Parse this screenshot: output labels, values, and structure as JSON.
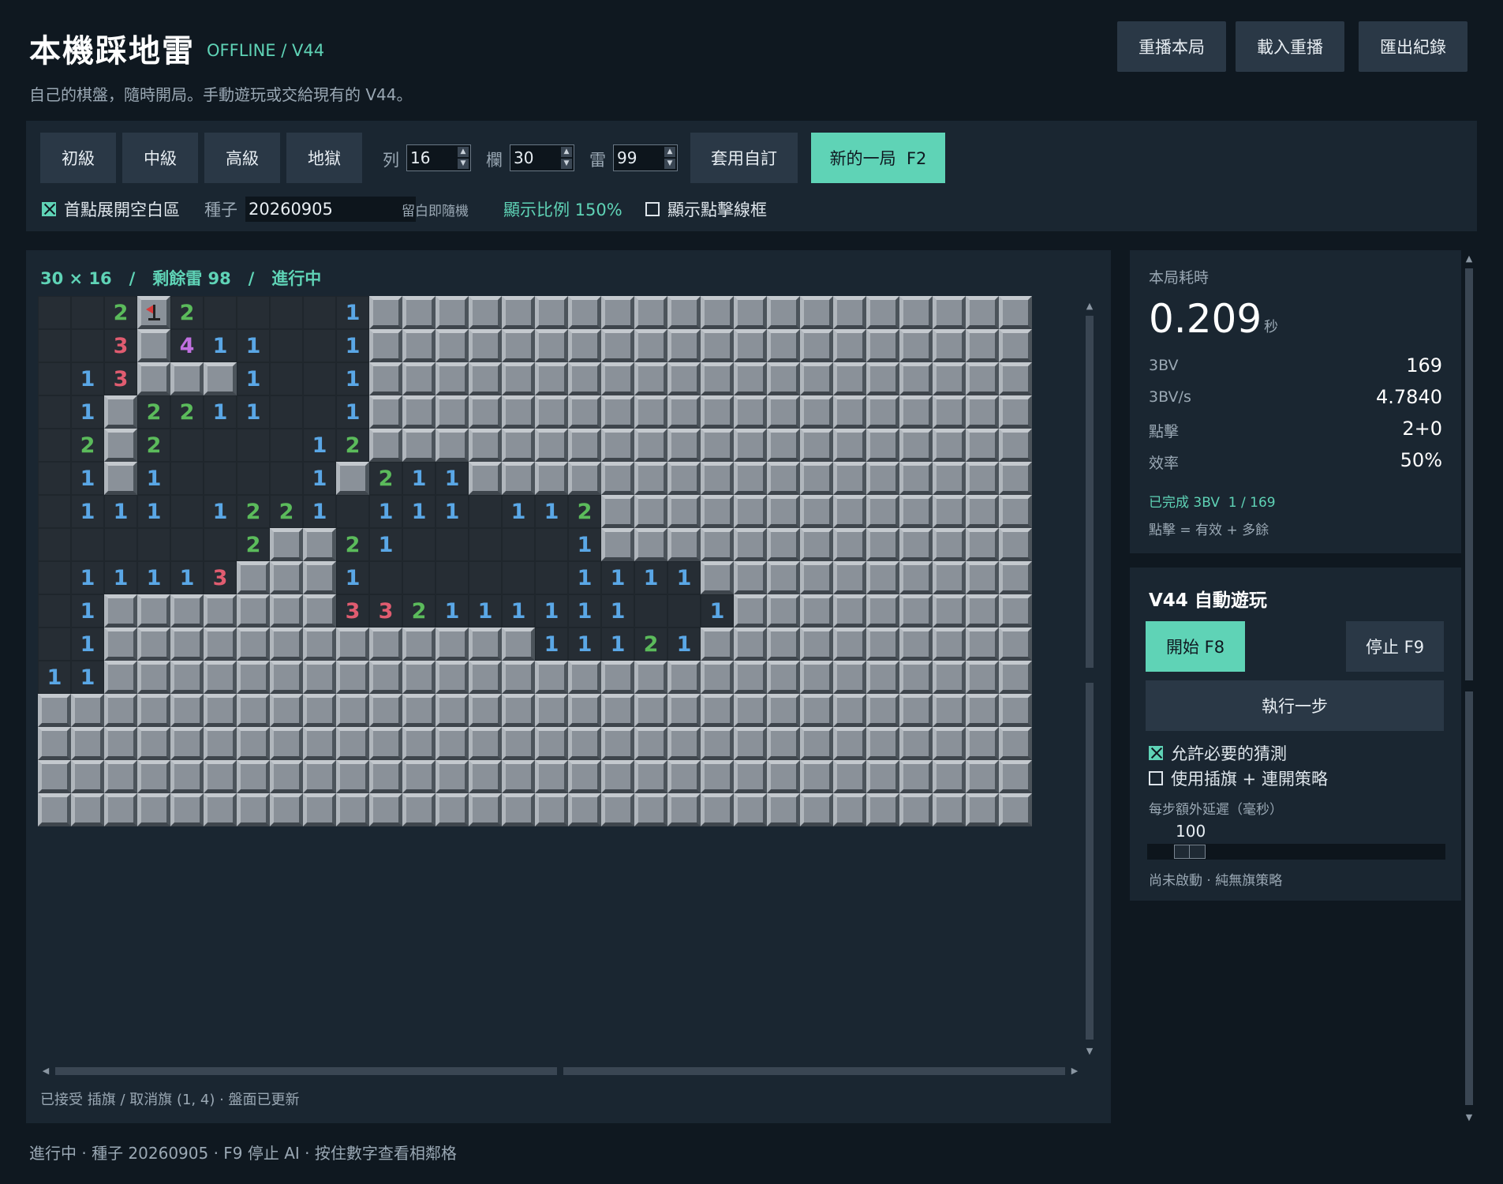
{
  "header": {
    "title": "本機踩地雷",
    "badge": "OFFLINE / V44",
    "subtitle": "自己的棋盤，隨時開局。手動遊玩或交給現有的 V44。",
    "buttons": [
      "重播本局",
      "載入重播",
      "匯出紀錄"
    ]
  },
  "toolbar": {
    "presets": [
      "初級",
      "中級",
      "高級",
      "地獄"
    ],
    "rows_label": "列",
    "rows_value": "16",
    "cols_label": "欄",
    "cols_value": "30",
    "mines_label": "雷",
    "mines_value": "99",
    "apply_custom": "套用自訂",
    "new_game": "新的一局  F2",
    "first_click_label": "首點展開空白區",
    "seed_label": "種子",
    "seed_value": "20260905",
    "seed_hint": "留白即隨機",
    "zoom": "顯示比例 150%",
    "show_grid_label": "顯示點擊線框"
  },
  "board": {
    "status": "30 × 16   /   剩餘雷 98   /   進行中",
    "footer": "已接受 插旗 / 取消旗 (1, 4) · 盤面已更新",
    "rows": [
      "..2F2....1####################",
      "..3#411..1####################",
      ".13###1..1####################",
      ".1#2211..1####################",
      ".2#2....12####################",
      ".1#1....1#211#################",
      ".111.1221.111.112#############",
      "......2##21.....1#############",
      ".11113###1......1111##########",
      ".1#######332111111..1#########",
      ".1#############11121##########",
      "11############################",
      "##############################",
      "##############################",
      "##############################",
      "##############################"
    ]
  },
  "stats": {
    "elapsed_label": "本局耗時",
    "elapsed_value": "0.209",
    "elapsed_unit": "秒",
    "bbbv_label": "3BV",
    "bbbv_value": "169",
    "bbbvs_label": "3BV/s",
    "bbbvs_value": "4.7840",
    "clicks_label": "點擊",
    "clicks_value": "2+0",
    "eff_label": "效率",
    "eff_value": "50%",
    "done": "已完成 3BV  1 / 169",
    "clicks_note": "點擊 = 有效 + 多餘"
  },
  "ai": {
    "title": "V44 自動遊玩",
    "start": "開始 F8",
    "stop": "停止 F9",
    "step": "執行一步",
    "opt_guess": "允許必要的猜測",
    "opt_flag": "使用插旗 + 連開策略",
    "delay_label": "每步額外延遲（毫秒）",
    "delay_value": "100",
    "delay_fraction": 0.08,
    "status": "尚未啟動 · 純無旗策略"
  },
  "footer": "進行中 · 種子 20260905 · F9 停止 AI · 按住數字查看相鄰格",
  "colors": {
    "accent": "#5fd3b6",
    "panel": "#1a2631",
    "button": "#2a3846",
    "background": "#0f1820"
  }
}
